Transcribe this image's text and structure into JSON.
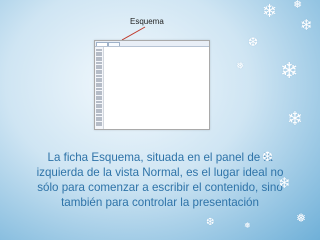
{
  "callout": {
    "label": "Esquema"
  },
  "screenshot": {
    "slide_rows": 30
  },
  "caption": {
    "line1": "La ficha Esquema, situada en el panel de la",
    "line2": "izquierda de la vista Normal, es el lugar ideal no",
    "line3": "sólo para comenzar a escribir el contenido, sino",
    "line4": "también para controlar la presentación"
  },
  "colors": {
    "caption_text": "#2e73a8",
    "background_edge": "#6fb0d8"
  },
  "decorations": {
    "icon": "snowflake-icon"
  }
}
